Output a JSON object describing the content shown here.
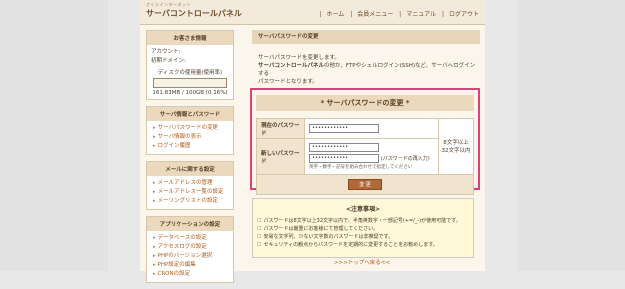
{
  "header": {
    "logo_small": "さくらインターネット",
    "logo_main": "サーバコントロールパネル",
    "nav": [
      "ホーム",
      "会員メニュー",
      "マニュアル",
      "ログアウト"
    ]
  },
  "sidebar": {
    "customer_info": {
      "title": "お客さま情報",
      "account_label": "アカウント:",
      "domain_label": "初期ドメイン:",
      "disk_label": "ディスクの使用量(使用率)",
      "disk_value": "161.83MB / 100GB (0.16%)",
      "disk_usage_percent": 0.16
    },
    "server_section": {
      "title": "サーバ情報とパスワード",
      "items": [
        "サーバパスワードの変更",
        "サーバ情報の表示",
        "ログイン履歴"
      ]
    },
    "mail_section": {
      "title": "メールに関する設定",
      "items": [
        "メールアドレスの管理",
        "メールアドレス一覧の設定",
        "メーリングリストの設定"
      ]
    },
    "app_section": {
      "title": "アプリケーションの設定",
      "items": [
        "データベースの設定",
        "アクセスログの設定",
        "PHPのバージョン選択",
        "PHP設定の編集",
        "CRONの設定"
      ]
    }
  },
  "main": {
    "title": "サーバパスワードの変更",
    "desc_line1": "サーバパスワードを変更します。",
    "desc_line2_bold": "サーバコントロールパネル",
    "desc_line2": "の他か、FTPやシェルログイン(SSH)など、サーバへログインする",
    "desc_line3": "パスワードとなります。",
    "form": {
      "title": "* サーバパスワードの変更 *",
      "current_label": "現在のパスワード",
      "current_value": "••••••••••••",
      "new_label": "新しいパスワード",
      "new_value": "••••••••••••",
      "confirm_value": "••••••••••••",
      "confirm_note": "(パスワードの再入力)",
      "hint": "英字・数字・記号を組み合わせて指定してください",
      "rule_line1": "8文字以上",
      "rule_line2": "32文字以内",
      "submit_label": "変 更"
    },
    "notice": {
      "title": "<注意事項>",
      "items": [
        "パスワードは8文字以上32文字以内で、半角英数字・一部記号(+=/_-)が使用可能です。",
        "パスワードは厳重にお客様にて管理してください。",
        "安易な文字列、少ない文字数のパスワードは非推奨です。",
        "セキュリティの観点からパスワードを定期的に変更することをお勧めします。"
      ]
    },
    "back_link": ">>>トップへ戻る<<"
  }
}
